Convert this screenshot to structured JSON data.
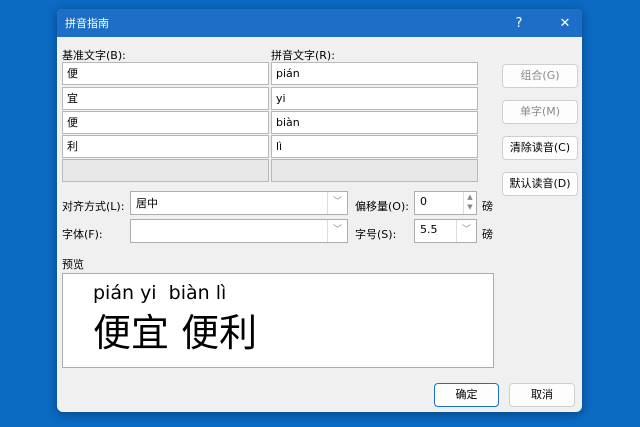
{
  "dialog": {
    "title": "拼音指南",
    "help": "?",
    "close": "✕"
  },
  "base_label": "基准文字(B):",
  "ruby_label": "拼音文字(R):",
  "rows": [
    {
      "base": "便",
      "ruby": "pián"
    },
    {
      "base": "宜",
      "ruby": "yi"
    },
    {
      "base": "便",
      "ruby": "biàn"
    },
    {
      "base": "利",
      "ruby": "lì"
    },
    {
      "base": "",
      "ruby": ""
    }
  ],
  "buttons": {
    "group": "组合(G)",
    "mono": "单字(M)",
    "clear": "清除读音(C)",
    "default": "默认读音(D)",
    "ok": "确定",
    "cancel": "取消"
  },
  "align": {
    "label": "对齐方式(L):",
    "value": "居中"
  },
  "offset": {
    "label": "偏移量(O):",
    "value": "0",
    "unit": "磅"
  },
  "font": {
    "label": "字体(F):",
    "value": ""
  },
  "size": {
    "label": "字号(S):",
    "value": "5.5",
    "unit": "磅"
  },
  "preview": {
    "label": "预览",
    "ruby": "pián yi  biàn lì",
    "text": "便宜 便利"
  }
}
